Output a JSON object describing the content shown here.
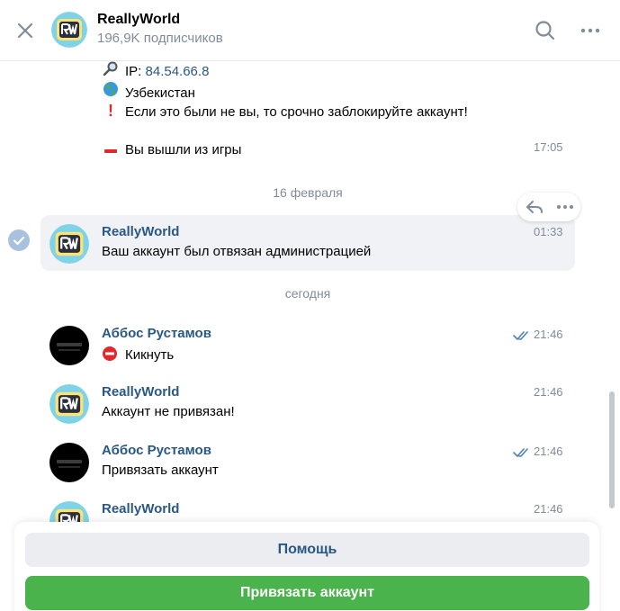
{
  "header": {
    "title": "ReallyWorld",
    "subtitle": "196,9K подписчиков",
    "icons": [
      "close-icon",
      "search-icon",
      "more-icon"
    ]
  },
  "messages_top": {
    "ip_label": "IP: ",
    "ip_value": "84.54.66.8",
    "country": "Узбекистан",
    "warning": "Если это были не вы, то срочно заблокируйте аккаунт!",
    "left_game": "Вы вышли из игры",
    "time": "17:05"
  },
  "date_separators": {
    "feb": "16 февраля",
    "today": "сегодня"
  },
  "messages": [
    {
      "author": "ReallyWorld",
      "text": "Ваш аккаунт был отвязан администрацией",
      "time": "01:33"
    },
    {
      "author": "Аббос Рустамов",
      "text": "Кикнуть",
      "time": "21:46"
    },
    {
      "author": "ReallyWorld",
      "text": "Аккаунт не привязан!",
      "time": "21:46"
    },
    {
      "author": "Аббос Рустамов",
      "text": "Привязать аккаунт",
      "time": "21:46"
    },
    {
      "author": "ReallyWorld",
      "text": "",
      "time": "21:46"
    }
  ],
  "keyboard": {
    "help": "Помощь",
    "link_account": "Привязать аккаунт"
  },
  "colors": {
    "link": "#2a5885",
    "muted": "#818c99",
    "accent_green": "#4bb34b",
    "highlight_bg": "#f0f2f5"
  }
}
